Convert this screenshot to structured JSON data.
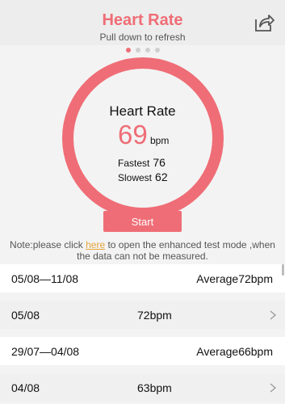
{
  "header": {
    "title": "Heart Rate",
    "subtitle": "Pull down to refresh",
    "share_icon": "share-icon"
  },
  "pager": {
    "count": 4,
    "active_index": 0
  },
  "measure": {
    "title": "Heart Rate",
    "value": "69",
    "unit": "bpm",
    "fastest_label": "Fastest",
    "fastest_value": "76",
    "slowest_label": "Slowest",
    "slowest_value": "62",
    "start_label": "Start"
  },
  "note": {
    "prefix": "Note:please click ",
    "link": "here",
    "suffix": " to open the enhanced test mode ,when the data can not be measured."
  },
  "history": [
    {
      "type": "week",
      "range": "05/08—11/08",
      "summary": "Average72bpm"
    },
    {
      "type": "day",
      "date": "05/08",
      "value": "72bpm"
    },
    {
      "type": "week",
      "range": "29/07—04/08",
      "summary": "Average66bpm"
    },
    {
      "type": "day",
      "date": "04/08",
      "value": "63bpm"
    }
  ],
  "colors": {
    "accent": "#ef6d76",
    "link": "#e3a43a"
  }
}
